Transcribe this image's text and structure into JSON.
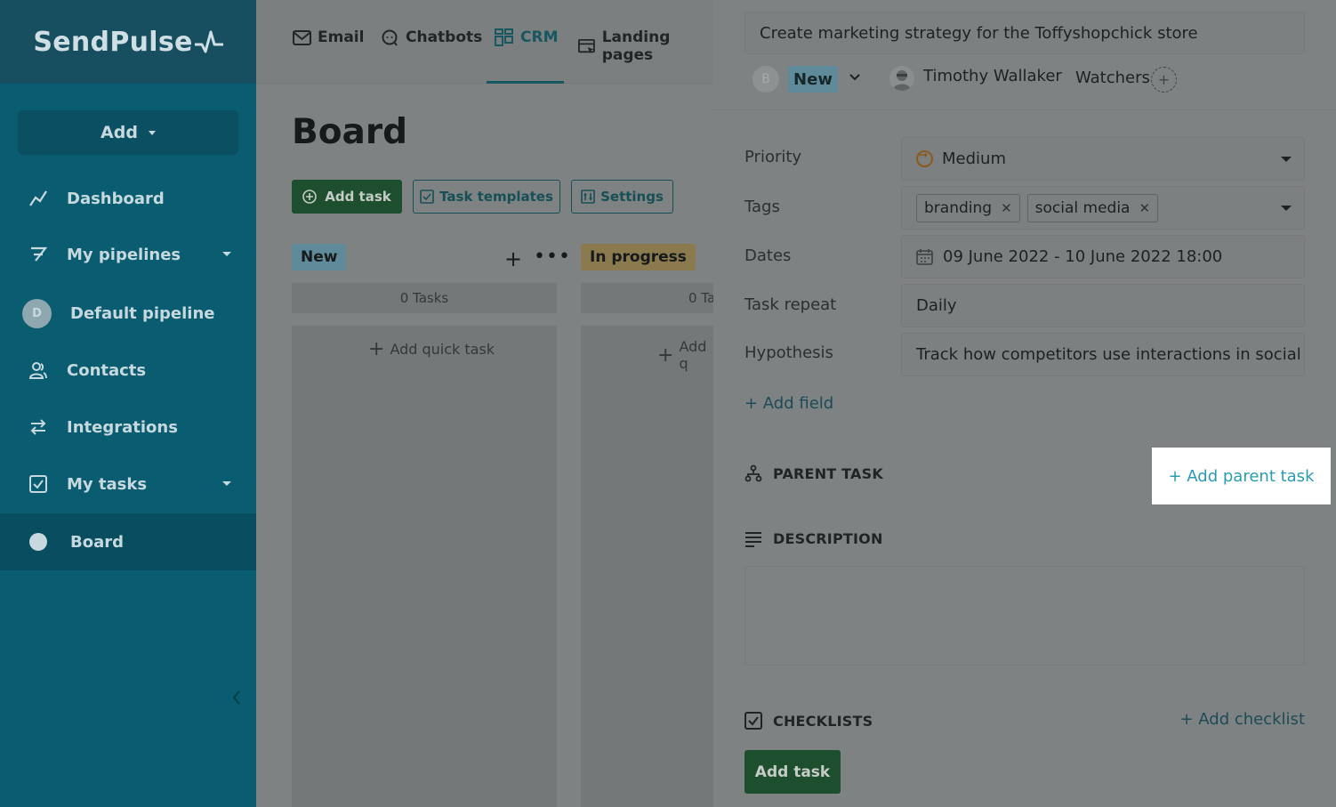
{
  "sidebar": {
    "logo": "SendPulse",
    "add_label": "Add",
    "items": [
      {
        "label": "Dashboard"
      },
      {
        "label": "My pipelines"
      },
      {
        "label": "Default pipeline",
        "badge": "D"
      },
      {
        "label": "Contacts"
      },
      {
        "label": "Integrations"
      },
      {
        "label": "My tasks"
      },
      {
        "label": "Board"
      }
    ]
  },
  "topnav": {
    "items": [
      {
        "label": "Email"
      },
      {
        "label": "Chatbots"
      },
      {
        "label": "CRM"
      },
      {
        "label": "Landing pages"
      }
    ]
  },
  "board": {
    "title": "Board",
    "add_task_label": "Add task",
    "templates_label": "Task templates",
    "settings_label": "Settings",
    "columns": [
      {
        "name": "New",
        "count": "0 Tasks",
        "quick_add": "Add quick task",
        "color": "#5f8a9a"
      },
      {
        "name": "In progress",
        "count": "0 Ta",
        "quick_add": "Add q",
        "color": "#8a7a4e"
      }
    ]
  },
  "task": {
    "title": "Create marketing strategy for the Toffyshopchick store",
    "status_avatar": "B",
    "status": "New",
    "assignee": "Timothy Wallaker",
    "watchers_label": "Watchers",
    "watchers_add": "+",
    "fields": {
      "priority_label": "Priority",
      "priority_value": "Medium",
      "tags_label": "Tags",
      "tags": [
        "branding",
        "social media"
      ],
      "dates_label": "Dates",
      "dates_value": "09 June 2022 - 10 June 2022 18:00",
      "repeat_label": "Task repeat",
      "repeat_value": "Daily",
      "hypothesis_label": "Hypothesis",
      "hypothesis_value": "Track how competitors use interactions in social media"
    },
    "add_field_label": "+ Add field",
    "parent_task_label": "PARENT TASK",
    "add_parent_label": "+ Add parent task",
    "description_label": "DESCRIPTION",
    "checklists_label": "CHECKLISTS",
    "add_checklist_label": "+ Add checklist",
    "add_task_label": "Add task"
  }
}
